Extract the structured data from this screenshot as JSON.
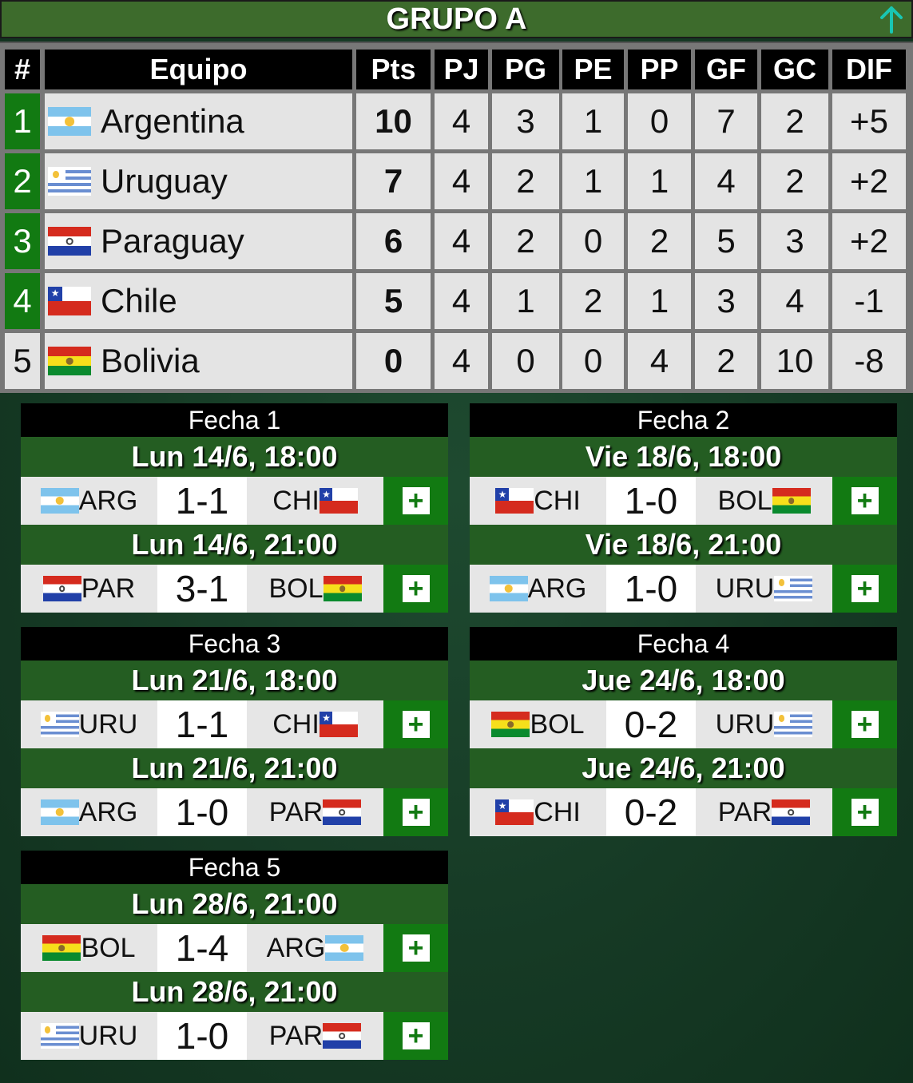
{
  "header": {
    "title": "GRUPO A"
  },
  "columns": [
    "#",
    "Equipo",
    "Pts",
    "PJ",
    "PG",
    "PE",
    "PP",
    "GF",
    "GC",
    "DIF"
  ],
  "standings": [
    {
      "pos": "1",
      "flag": "arg",
      "team": "Argentina",
      "pts": "10",
      "pj": "4",
      "pg": "3",
      "pe": "1",
      "pp": "0",
      "gf": "7",
      "gc": "2",
      "dif": "+5"
    },
    {
      "pos": "2",
      "flag": "uru",
      "team": "Uruguay",
      "pts": "7",
      "pj": "4",
      "pg": "2",
      "pe": "1",
      "pp": "1",
      "gf": "4",
      "gc": "2",
      "dif": "+2"
    },
    {
      "pos": "3",
      "flag": "par",
      "team": "Paraguay",
      "pts": "6",
      "pj": "4",
      "pg": "2",
      "pe": "0",
      "pp": "2",
      "gf": "5",
      "gc": "3",
      "dif": "+2"
    },
    {
      "pos": "4",
      "flag": "chi",
      "team": "Chile",
      "pts": "5",
      "pj": "4",
      "pg": "1",
      "pe": "2",
      "pp": "1",
      "gf": "3",
      "gc": "4",
      "dif": "-1"
    },
    {
      "pos": "5",
      "flag": "bol",
      "team": "Bolivia",
      "pts": "0",
      "pj": "4",
      "pg": "0",
      "pe": "0",
      "pp": "4",
      "gf": "2",
      "gc": "10",
      "dif": "-8"
    }
  ],
  "fixtures": [
    {
      "title": "Fecha 1",
      "matches": [
        {
          "date": "Lun 14/6, 18:00",
          "home": "ARG",
          "home_flag": "arg",
          "score": "1-1",
          "away": "CHI",
          "away_flag": "chi",
          "plus": "+"
        },
        {
          "date": "Lun 14/6, 21:00",
          "home": "PAR",
          "home_flag": "par",
          "score": "3-1",
          "away": "BOL",
          "away_flag": "bol",
          "plus": "+"
        }
      ]
    },
    {
      "title": "Fecha 2",
      "matches": [
        {
          "date": "Vie 18/6, 18:00",
          "home": "CHI",
          "home_flag": "chi",
          "score": "1-0",
          "away": "BOL",
          "away_flag": "bol",
          "plus": "+"
        },
        {
          "date": "Vie 18/6, 21:00",
          "home": "ARG",
          "home_flag": "arg",
          "score": "1-0",
          "away": "URU",
          "away_flag": "uru",
          "plus": "+"
        }
      ]
    },
    {
      "title": "Fecha 3",
      "matches": [
        {
          "date": "Lun 21/6, 18:00",
          "home": "URU",
          "home_flag": "uru",
          "score": "1-1",
          "away": "CHI",
          "away_flag": "chi",
          "plus": "+"
        },
        {
          "date": "Lun 21/6, 21:00",
          "home": "ARG",
          "home_flag": "arg",
          "score": "1-0",
          "away": "PAR",
          "away_flag": "par",
          "plus": "+"
        }
      ]
    },
    {
      "title": "Fecha 4",
      "matches": [
        {
          "date": "Jue 24/6, 18:00",
          "home": "BOL",
          "home_flag": "bol",
          "score": "0-2",
          "away": "URU",
          "away_flag": "uru",
          "plus": "+"
        },
        {
          "date": "Jue 24/6, 21:00",
          "home": "CHI",
          "home_flag": "chi",
          "score": "0-2",
          "away": "PAR",
          "away_flag": "par",
          "plus": "+"
        }
      ]
    },
    {
      "title": "Fecha 5",
      "matches": [
        {
          "date": "Lun 28/6, 21:00",
          "home": "BOL",
          "home_flag": "bol",
          "score": "1-4",
          "away": "ARG",
          "away_flag": "arg",
          "plus": "+"
        },
        {
          "date": "Lun 28/6, 21:00",
          "home": "URU",
          "home_flag": "uru",
          "score": "1-0",
          "away": "PAR",
          "away_flag": "par",
          "plus": "+"
        }
      ]
    }
  ],
  "colors": {
    "header_bg": "#3d6b2c",
    "qualified_green": "#127a12",
    "date_row_green": "#245d22",
    "arrow_teal": "#19c6b3"
  },
  "icons": {
    "scroll_top": "arrow-up-icon",
    "expand_match": "plus-icon"
  }
}
